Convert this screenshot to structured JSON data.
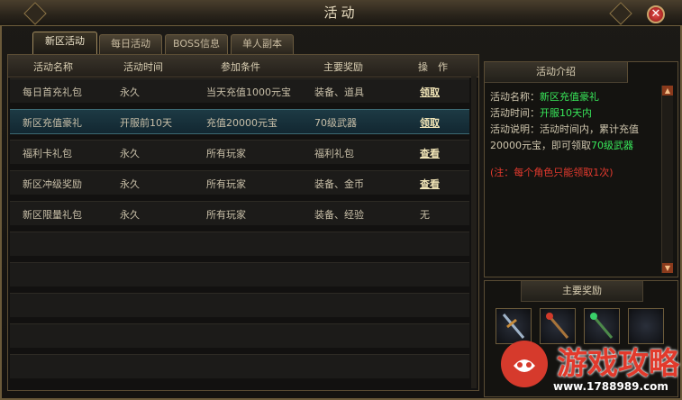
{
  "window": {
    "title": "活动",
    "close_label": "✕"
  },
  "tabs": [
    "新区活动",
    "每日活动",
    "BOSS信息",
    "单人副本"
  ],
  "table": {
    "headers": [
      "活动名称",
      "活动时间",
      "参加条件",
      "主要奖励",
      "操　作"
    ],
    "rows": [
      {
        "name": "每日首充礼包",
        "time": "永久",
        "condition": "当天充值1000元宝",
        "reward": "装备、道具",
        "action": "领取",
        "action_link": true
      },
      {
        "name": "新区充值豪礼",
        "time": "开服前10天",
        "condition": "充值20000元宝",
        "reward": "70级武器",
        "action": "领取",
        "action_link": true
      },
      {
        "name": "福利卡礼包",
        "time": "永久",
        "condition": "所有玩家",
        "reward": "福利礼包",
        "action": "查看",
        "action_link": true
      },
      {
        "name": "新区冲级奖励",
        "time": "永久",
        "condition": "所有玩家",
        "reward": "装备、金币",
        "action": "查看",
        "action_link": true
      },
      {
        "name": "新区限量礼包",
        "time": "永久",
        "condition": "所有玩家",
        "reward": "装备、经验",
        "action": "无",
        "action_link": false
      }
    ]
  },
  "intro": {
    "header": "活动介绍",
    "name_label": "活动名称：",
    "name_value": "新区充值豪礼",
    "time_label": "活动时间：",
    "time_value": "开服10天内",
    "desc_label": "活动说明：活动时间内，累计充值20000元宝，即可领取",
    "desc_value": "70级武器",
    "note": "(注：每个角色只能领取1次)"
  },
  "rewards": {
    "header": "主要奖励",
    "items": [
      "sword-icon",
      "staff-icon",
      "staff-icon",
      "empty-slot"
    ]
  },
  "watermark": {
    "text": "游戏攻略",
    "url": "www.1788989.com"
  },
  "colors": {
    "accent_green": "#38e85a",
    "note_red": "#e53a2e",
    "selected_row": "#1d3a44"
  }
}
